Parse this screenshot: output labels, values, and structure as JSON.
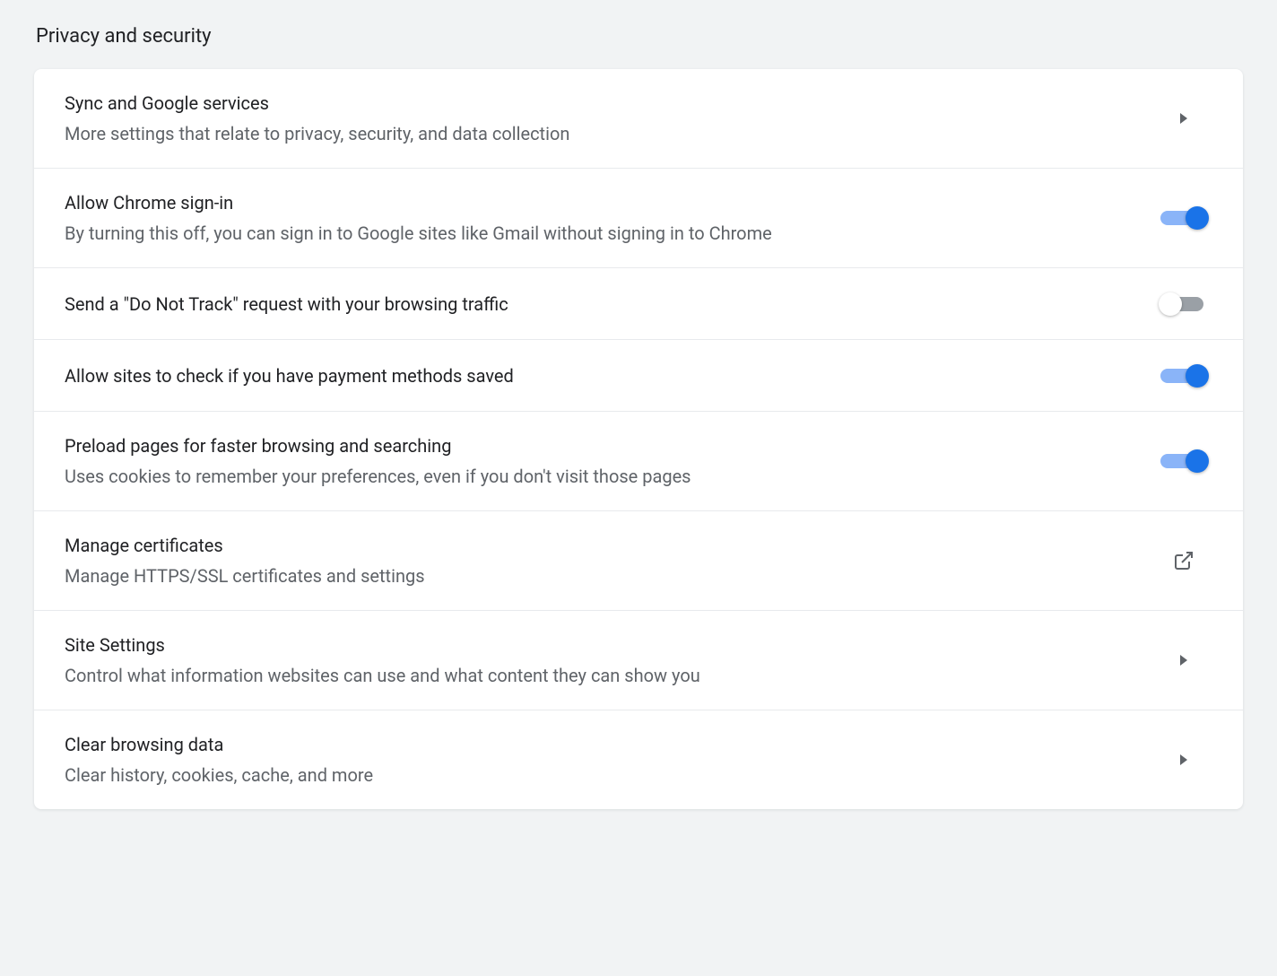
{
  "section": {
    "title": "Privacy and security"
  },
  "items": [
    {
      "title": "Sync and Google services",
      "subtitle": "More settings that relate to privacy, security, and data collection",
      "action": "chevron"
    },
    {
      "title": "Allow Chrome sign-in",
      "subtitle": "By turning this off, you can sign in to Google sites like Gmail without signing in to Chrome",
      "action": "toggle",
      "enabled": true
    },
    {
      "title": "Send a \"Do Not Track\" request with your browsing traffic",
      "action": "toggle",
      "enabled": false
    },
    {
      "title": "Allow sites to check if you have payment methods saved",
      "action": "toggle",
      "enabled": true
    },
    {
      "title": "Preload pages for faster browsing and searching",
      "subtitle": "Uses cookies to remember your preferences, even if you don't visit those pages",
      "action": "toggle",
      "enabled": true
    },
    {
      "title": "Manage certificates",
      "subtitle": "Manage HTTPS/SSL certificates and settings",
      "action": "external"
    },
    {
      "title": "Site Settings",
      "subtitle": "Control what information websites can use and what content they can show you",
      "action": "chevron"
    },
    {
      "title": "Clear browsing data",
      "subtitle": "Clear history, cookies, cache, and more",
      "action": "chevron"
    }
  ]
}
